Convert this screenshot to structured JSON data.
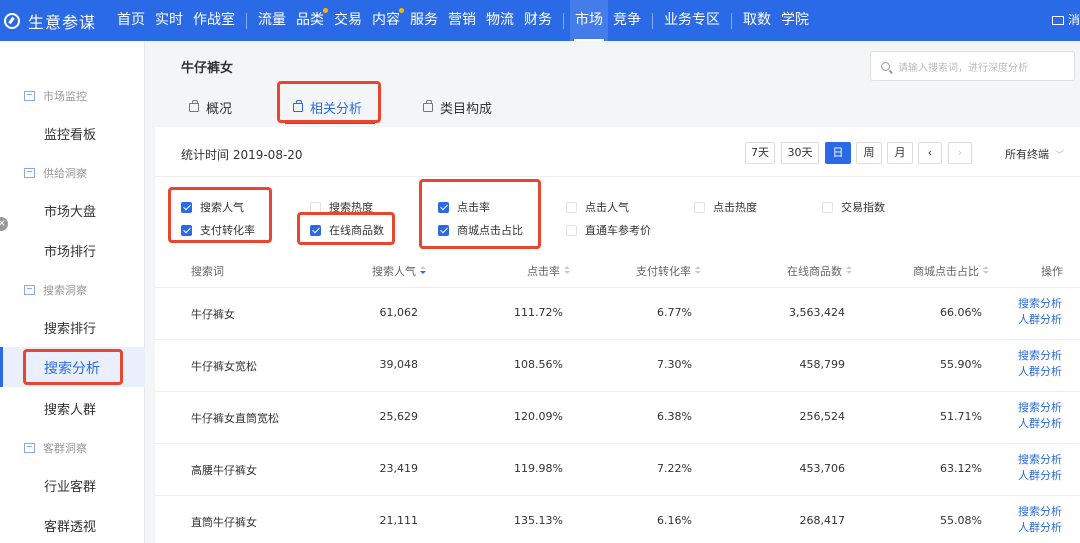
{
  "app": {
    "name": "生意参谋"
  },
  "nav": {
    "group1": [
      "首页",
      "实时",
      "作战室"
    ],
    "group2": [
      "流量",
      "品类",
      "交易",
      "内容",
      "服务",
      "营销",
      "物流",
      "财务"
    ],
    "active": "市场",
    "group3_rest": "竞争",
    "group4": [
      "业务专区"
    ],
    "group5": [
      "取数",
      "学院"
    ],
    "message": "消"
  },
  "sidebar": {
    "groups": [
      {
        "label": "市场监控",
        "items": [
          "监控看板"
        ]
      },
      {
        "label": "供给洞察",
        "items": [
          "市场大盘",
          "市场排行"
        ]
      },
      {
        "label": "搜索洞察",
        "items": [
          "搜索排行",
          "搜索分析",
          "搜索人群"
        ]
      },
      {
        "label": "客群洞察",
        "items": [
          "行业客群",
          "客群透视"
        ]
      }
    ],
    "selected": "搜索分析"
  },
  "main": {
    "title": "牛仔裤女",
    "search_placeholder": "请输入搜索词，进行深度分析",
    "tabs": [
      "概况",
      "相关分析",
      "类目构成"
    ],
    "active_tab": "相关分析",
    "stat_time": "统计时间 2019-08-20",
    "periods": [
      "7天",
      "30天",
      "日",
      "周",
      "月"
    ],
    "active_period": "日",
    "prev": "‹",
    "next": "›",
    "terminal": "所有终端",
    "terminal_chevron": "﹀"
  },
  "metrics": [
    {
      "label": "搜索人气",
      "checked": true
    },
    {
      "label": "支付转化率",
      "checked": true
    },
    {
      "label": "搜索热度",
      "checked": false
    },
    {
      "label": "在线商品数",
      "checked": true
    },
    {
      "label": "点击率",
      "checked": true
    },
    {
      "label": "商城点击占比",
      "checked": true
    },
    {
      "label": "点击人气",
      "checked": false
    },
    {
      "label": "直通车参考价",
      "checked": false
    },
    {
      "label": "点击热度",
      "checked": false
    },
    {
      "label": "交易指数",
      "checked": false
    }
  ],
  "table": {
    "headers": [
      "搜索词",
      "搜索人气",
      "点击率",
      "支付转化率",
      "在线商品数",
      "商城点击占比",
      "操作"
    ],
    "rows": [
      [
        "牛仔裤女",
        "61,062",
        "111.72%",
        "6.77%",
        "3,563,424",
        "66.06%"
      ],
      [
        "牛仔裤女宽松",
        "39,048",
        "108.56%",
        "7.30%",
        "458,799",
        "55.90%"
      ],
      [
        "牛仔裤女直筒宽松",
        "25,629",
        "120.09%",
        "6.38%",
        "256,524",
        "51.71%"
      ],
      [
        "高腰牛仔裤女",
        "23,419",
        "119.98%",
        "7.22%",
        "453,706",
        "63.12%"
      ],
      [
        "直筒牛仔裤女",
        "21,111",
        "135.13%",
        "6.16%",
        "268,417",
        "55.08%"
      ]
    ],
    "actions": [
      "搜索分析",
      "人群分析"
    ]
  },
  "colors": {
    "brand": "#2b6ae6",
    "highlight": "#e8462f"
  }
}
